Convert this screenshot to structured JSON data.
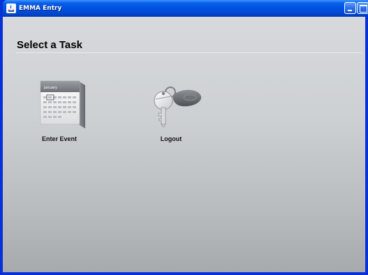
{
  "window": {
    "title": "EMMA Entry"
  },
  "titlebar": {
    "icons": [
      "java-app-icon",
      "minimize-icon",
      "maximize-icon",
      "close-icon"
    ]
  },
  "main": {
    "heading": "Select a Task",
    "tasks": [
      {
        "label": "Enter Event",
        "icon": "calendar-icon",
        "calendar_month": "January"
      },
      {
        "label": "Logout",
        "icon": "key-icon"
      }
    ]
  },
  "colors": {
    "titlebar_blue": "#0054e3",
    "content_top": "#d7d9dc",
    "content_bottom": "#a7aaad"
  }
}
